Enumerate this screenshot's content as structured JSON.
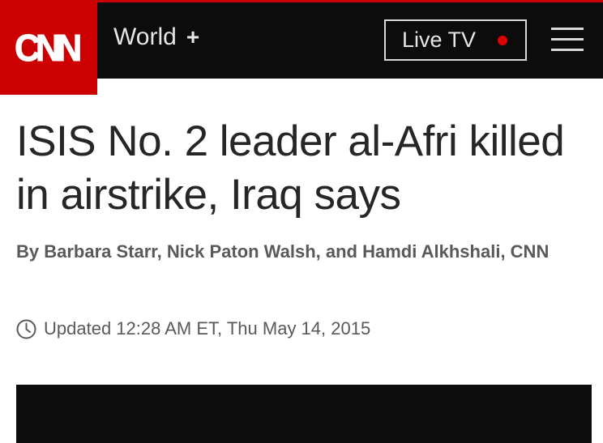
{
  "header": {
    "logo_text": "CNN",
    "section_label": "World",
    "section_toggle": "+",
    "live_tv_label": "Live TV"
  },
  "article": {
    "headline": "ISIS No. 2 leader al-Afri killed in airstrike, Iraq says",
    "byline": "By Barbara Starr, Nick Paton Walsh, and Hamdi Alkhshali, CNN",
    "timestamp": "Updated 12:28 AM ET, Thu May 14, 2015"
  },
  "icons": {
    "clock": "clock-icon",
    "menu": "hamburger-menu-icon",
    "live": "live-indicator-dot"
  },
  "colors": {
    "brand_red": "#cc0000",
    "header_bg": "#0c0c0c",
    "live_dot": "#e00000",
    "headline_text": "#262626",
    "meta_text": "#595959"
  }
}
